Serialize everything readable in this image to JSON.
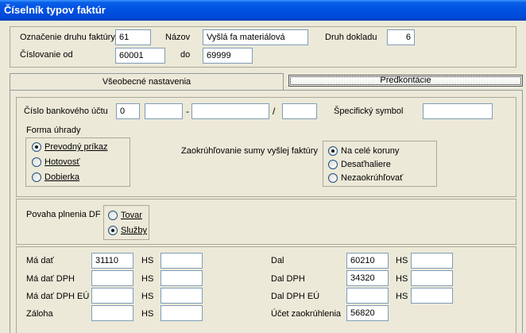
{
  "window": {
    "title": "Číselník typov faktúr"
  },
  "header": {
    "oznacenie_label": "Označenie druhu faktúry",
    "oznacenie_value": "61",
    "nazov_label": "Názov",
    "nazov_value": "Vyšlá fa materiálová",
    "druh_dokladu_label": "Druh dokladu",
    "druh_dokladu_value": "6",
    "cislovanie_label": "Číslovanie od",
    "cislovanie_od_value": "60001",
    "do_label": "do",
    "cislovanie_do_value": "69999"
  },
  "tabs": [
    {
      "label": "Všeobecné nastavenia",
      "active": true
    },
    {
      "label": "Predkontácie",
      "active": false
    }
  ],
  "bank": {
    "label": "Číslo bankového účtu",
    "prefix_value": "0",
    "part2_value": "",
    "dash": "-",
    "account_value": "",
    "slash": "/",
    "bank_code_value": "",
    "specific_symbol_label": "Špecifický symbol",
    "specific_symbol_value": ""
  },
  "payment": {
    "label": "Forma úhrady",
    "options": [
      {
        "label": "Prevodný príkaz",
        "selected": true
      },
      {
        "label": "Hotovosť",
        "selected": false
      },
      {
        "label": "Dobierka",
        "selected": false
      }
    ]
  },
  "rounding": {
    "label": "Zaokrúhľovanie sumy vyšlej faktúry",
    "options": [
      {
        "label": "Na celé koruny",
        "selected": true
      },
      {
        "label": "Desaťhaliere",
        "selected": false
      },
      {
        "label": "Nezaokrúhľovať",
        "selected": false
      }
    ]
  },
  "povaha": {
    "label": "Povaha plnenia DF",
    "options": [
      {
        "label": "Tovar",
        "selected": false
      },
      {
        "label": "Služby",
        "selected": true
      }
    ]
  },
  "accounts": {
    "hs_label": "HS",
    "left": [
      {
        "label": "Má dať",
        "value": "31110",
        "hs": ""
      },
      {
        "label": "Má dať DPH",
        "value": "",
        "hs": ""
      },
      {
        "label": "Má dať DPH EÚ",
        "value": "",
        "hs": ""
      },
      {
        "label": "Záloha",
        "value": "",
        "hs": ""
      }
    ],
    "right": [
      {
        "label": "Dal",
        "value": "60210",
        "hs": ""
      },
      {
        "label": "Dal DPH",
        "value": "34320",
        "hs": ""
      },
      {
        "label": "Dal DPH EÚ",
        "value": "",
        "hs": ""
      }
    ],
    "zaokruhlenie_label": "Účet zaokrúhlenia",
    "zaokruhlenie_value": "56820"
  }
}
